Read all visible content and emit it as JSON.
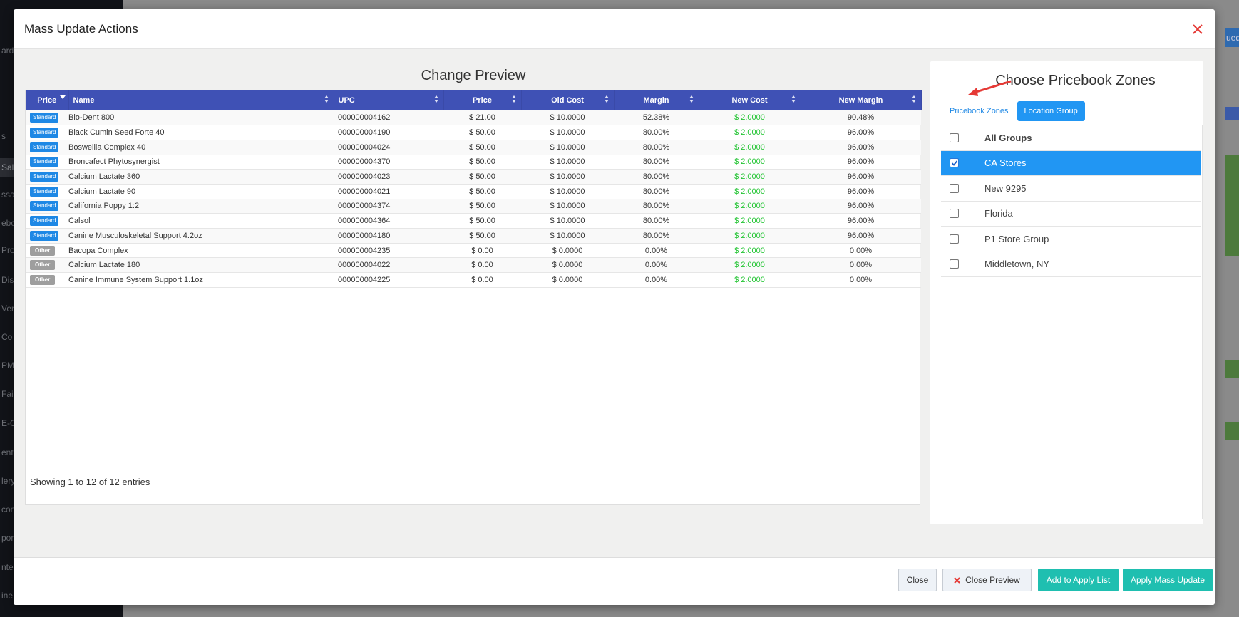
{
  "background": {
    "sidebar_items": [
      "ard",
      "s",
      "Sal",
      "ssa",
      "ebo",
      "Pro",
      "Dis",
      "Ver",
      "Co",
      "PM",
      "Fai",
      "E-C",
      "ento",
      "lery",
      "cond",
      "ports",
      "ntel",
      "ine"
    ],
    "right_label": "ued"
  },
  "modal": {
    "title": "Mass Update Actions"
  },
  "preview": {
    "title": "Change Preview",
    "columns": [
      "Price",
      "Name",
      "UPC",
      "Price",
      "Old Cost",
      "Margin",
      "New Cost",
      "New Margin"
    ],
    "rows": [
      {
        "badge": "Standard",
        "name": "Bio-Dent 800",
        "upc": "000000004162",
        "price": "$ 21.00",
        "old_cost": "$ 10.0000",
        "margin": "52.38%",
        "new_cost": "$ 2.0000",
        "new_margin": "90.48%"
      },
      {
        "badge": "Standard",
        "name": "Black Cumin Seed Forte 40",
        "upc": "000000004190",
        "price": "$ 50.00",
        "old_cost": "$ 10.0000",
        "margin": "80.00%",
        "new_cost": "$ 2.0000",
        "new_margin": "96.00%"
      },
      {
        "badge": "Standard",
        "name": "Boswellia Complex 40",
        "upc": "000000004024",
        "price": "$ 50.00",
        "old_cost": "$ 10.0000",
        "margin": "80.00%",
        "new_cost": "$ 2.0000",
        "new_margin": "96.00%"
      },
      {
        "badge": "Standard",
        "name": "Broncafect Phytosynergist",
        "upc": "000000004370",
        "price": "$ 50.00",
        "old_cost": "$ 10.0000",
        "margin": "80.00%",
        "new_cost": "$ 2.0000",
        "new_margin": "96.00%"
      },
      {
        "badge": "Standard",
        "name": "Calcium Lactate 360",
        "upc": "000000004023",
        "price": "$ 50.00",
        "old_cost": "$ 10.0000",
        "margin": "80.00%",
        "new_cost": "$ 2.0000",
        "new_margin": "96.00%"
      },
      {
        "badge": "Standard",
        "name": "Calcium Lactate 90",
        "upc": "000000004021",
        "price": "$ 50.00",
        "old_cost": "$ 10.0000",
        "margin": "80.00%",
        "new_cost": "$ 2.0000",
        "new_margin": "96.00%"
      },
      {
        "badge": "Standard",
        "name": "California Poppy 1:2",
        "upc": "000000004374",
        "price": "$ 50.00",
        "old_cost": "$ 10.0000",
        "margin": "80.00%",
        "new_cost": "$ 2.0000",
        "new_margin": "96.00%"
      },
      {
        "badge": "Standard",
        "name": "Calsol",
        "upc": "000000004364",
        "price": "$ 50.00",
        "old_cost": "$ 10.0000",
        "margin": "80.00%",
        "new_cost": "$ 2.0000",
        "new_margin": "96.00%"
      },
      {
        "badge": "Standard",
        "name": "Canine Musculoskeletal Support 4.2oz",
        "upc": "000000004180",
        "price": "$ 50.00",
        "old_cost": "$ 10.0000",
        "margin": "80.00%",
        "new_cost": "$ 2.0000",
        "new_margin": "96.00%"
      },
      {
        "badge": "Other",
        "name": "Bacopa Complex",
        "upc": "000000004235",
        "price": "$ 0.00",
        "old_cost": "$ 0.0000",
        "margin": "0.00%",
        "new_cost": "$ 2.0000",
        "new_margin": "0.00%"
      },
      {
        "badge": "Other",
        "name": "Calcium Lactate 180",
        "upc": "000000004022",
        "price": "$ 0.00",
        "old_cost": "$ 0.0000",
        "margin": "0.00%",
        "new_cost": "$ 2.0000",
        "new_margin": "0.00%"
      },
      {
        "badge": "Other",
        "name": "Canine Immune System Support 1.1oz",
        "upc": "000000004225",
        "price": "$ 0.00",
        "old_cost": "$ 0.0000",
        "margin": "0.00%",
        "new_cost": "$ 2.0000",
        "new_margin": "0.00%"
      }
    ],
    "showing": "Showing 1 to 12 of 12 entries"
  },
  "zones": {
    "title": "Choose Pricebook Zones",
    "tab_pricebook": "Pricebook Zones",
    "tab_location": "Location Group",
    "groups": [
      {
        "label": "All Groups",
        "checked": false
      },
      {
        "label": "CA Stores",
        "checked": true
      },
      {
        "label": "New 9295",
        "checked": false
      },
      {
        "label": "Florida",
        "checked": false
      },
      {
        "label": "P1 Store Group",
        "checked": false
      },
      {
        "label": "Middletown, NY",
        "checked": false
      }
    ]
  },
  "footer": {
    "close": "Close",
    "close_preview": "Close Preview",
    "add_to_apply": "Add to Apply List",
    "apply_mass": "Apply Mass Update"
  },
  "colors": {
    "header_blue": "#3f51b5",
    "accent_blue": "#2196f3",
    "teal": "#1fbfb0",
    "green": "#22c432",
    "close_red": "#e53935"
  }
}
